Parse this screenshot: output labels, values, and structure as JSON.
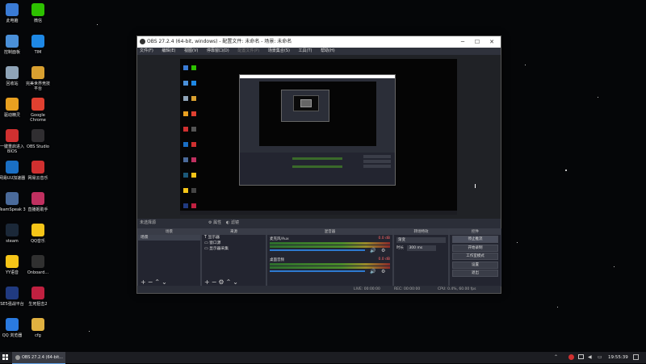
{
  "desktop": {
    "icons": [
      {
        "label": "此电脑",
        "color": "#3a7bd5"
      },
      {
        "label": "微信",
        "color": "#2dc100"
      },
      {
        "label": "控制面板",
        "color": "#4a90d9"
      },
      {
        "label": "TIM",
        "color": "#1e88e5"
      },
      {
        "label": "回收站",
        "color": "#8fa4b8"
      },
      {
        "label": "完美世界竞技平台",
        "color": "#d9a030"
      },
      {
        "label": "驱动精灵",
        "color": "#e8a020"
      },
      {
        "label": "Google Chrome",
        "color": "#e04030"
      },
      {
        "label": "一键重启进入BIOS",
        "color": "#d03030"
      },
      {
        "label": "OBS Studio",
        "color": "#302e31"
      },
      {
        "label": "网易UU加速器",
        "color": "#1a6fc4"
      },
      {
        "label": "网易云音乐",
        "color": "#d03030"
      },
      {
        "label": "TeamSpeak 3",
        "color": "#4a6a9a"
      },
      {
        "label": "直播姬助手",
        "color": "#c03060"
      },
      {
        "label": "steam",
        "color": "#1b2838"
      },
      {
        "label": "QQ音乐",
        "color": "#f5c518"
      },
      {
        "label": "YY语音",
        "color": "#f5c518"
      },
      {
        "label": "Onboard...",
        "color": "#303030"
      },
      {
        "label": "SE5强战平台",
        "color": "#203a80"
      },
      {
        "label": "生死狙击2",
        "color": "#c02040"
      },
      {
        "label": "QQ 浏览器",
        "color": "#2a7ae0"
      },
      {
        "label": "cfg",
        "color": "#e0b040"
      }
    ]
  },
  "obs": {
    "title": "OBS 27.2.4 (64-bit, windows) - 配置文件: 未命名 - 场景: 未命名",
    "menu": [
      "文件(F)",
      "编辑(E)",
      "视图(V)",
      "停靠窗口(D)",
      "配置文件(P)",
      "场景集合(S)",
      "工具(T)",
      "帮助(H)"
    ],
    "scene_info": "未选择源",
    "props_btn": "属性",
    "filters_btn": "滤镜",
    "scenes": {
      "header": "场景",
      "items": [
        "场景"
      ]
    },
    "sources": {
      "header": "来源",
      "items": [
        "显示器",
        "窗口源",
        "显示器采集"
      ]
    },
    "mixer": {
      "header": "混音器",
      "channels": [
        {
          "name": "麦克风/Aux",
          "db": "0.0 dB"
        },
        {
          "name": "桌面音频",
          "db": "0.0 dB"
        }
      ]
    },
    "transitions": {
      "header": "转场特效",
      "type": "渐变",
      "duration_label": "时长",
      "duration": "300 ms"
    },
    "controls": {
      "header": "控件",
      "buttons": [
        "停止推流",
        "开始录制",
        "工作室模式",
        "设置",
        "退出"
      ]
    },
    "status": {
      "live": "LIVE: 00:00:00",
      "rec": "REC: 00:00:00",
      "cpu": "CPU: 0.4%, 60.00 fps"
    }
  },
  "taskbar": {
    "active": "OBS 27.2.4 (64-bit..."
  },
  "clock": "19:55:39"
}
